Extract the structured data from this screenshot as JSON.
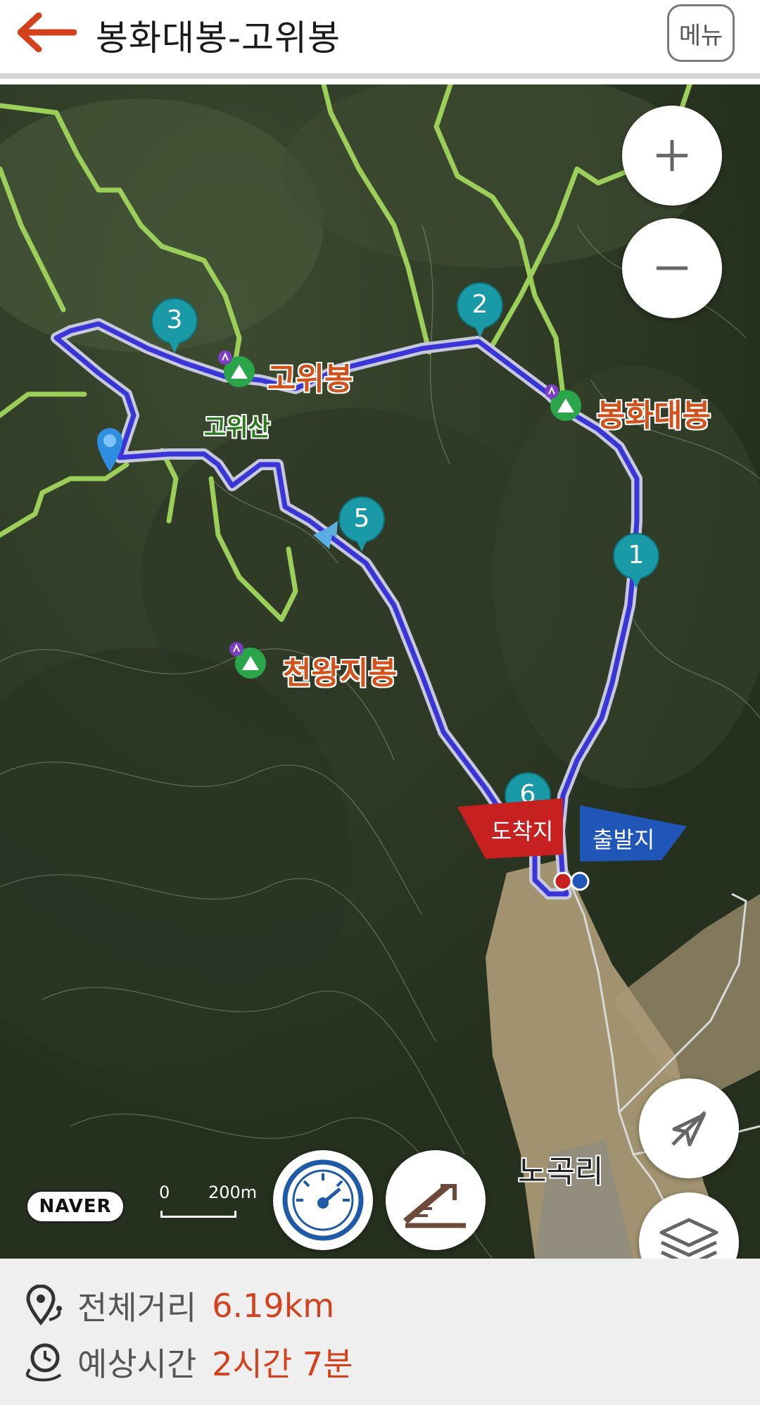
{
  "header": {
    "title": "봉화대봉-고위봉",
    "menu_label": "메뉴"
  },
  "map": {
    "peak_labels": {
      "gowibong": "고위봉",
      "bonghwadaebong": "봉화대봉",
      "cheonwangjibong": "천왕지봉",
      "gowisan": "고위산"
    },
    "start_flag": "출발지",
    "end_flag": "도착지",
    "village": "노곡리",
    "waypoints": [
      "1",
      "2",
      "3",
      "5",
      "6"
    ],
    "brand": "NAVER",
    "scale": {
      "min": "0",
      "max": "200m"
    },
    "colors": {
      "route": "#3a35d6",
      "trail": "#9ccf5a",
      "waypoint": "#1a9aa6",
      "start": "#1f56b8",
      "end": "#c62020"
    }
  },
  "summary": {
    "distance_label": "전체거리",
    "distance_value": "6.19km",
    "time_label": "예상시간",
    "time_value": "2시간 7분"
  }
}
